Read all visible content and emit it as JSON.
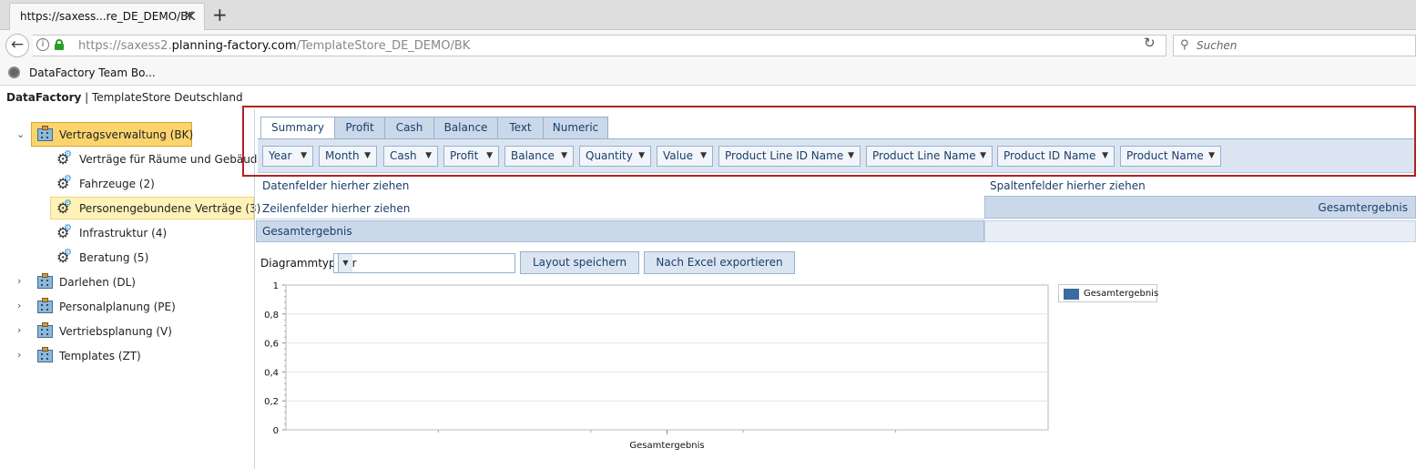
{
  "browser": {
    "tab_title": "https://saxess...re_DE_DEMO/BK",
    "url_prefix": "https://saxess2.",
    "url_host": "planning-factory.com",
    "url_path": "/TemplateStore_DE_DEMO/BK",
    "search_placeholder": "Suchen",
    "bookmark": "DataFactory Team Bo..."
  },
  "app": {
    "brand": "DataFactory",
    "separator": " | ",
    "subtitle": "TemplateStore Deutschland"
  },
  "tree": {
    "root_label": "Vertragsverwaltung (BK)",
    "children": [
      {
        "label": "Verträge für Räume und Gebäude"
      },
      {
        "label": "Fahrzeuge (2)"
      },
      {
        "label": "Personengebundene Verträge (3)"
      },
      {
        "label": "Infrastruktur (4)"
      },
      {
        "label": "Beratung (5)"
      }
    ],
    "others": [
      {
        "label": "Darlehen (DL)"
      },
      {
        "label": "Personalplanung (PE)"
      },
      {
        "label": "Vertriebsplanung (V)"
      },
      {
        "label": "Templates (ZT)"
      }
    ]
  },
  "pivot": {
    "tabs": [
      "Summary",
      "Profit",
      "Cash",
      "Balance",
      "Text",
      "Numeric"
    ],
    "active_tab": "Summary",
    "fields": [
      "Year",
      "Month",
      "Cash",
      "Profit",
      "Balance",
      "Quantity",
      "Value",
      "Product Line ID Name",
      "Product Line Name",
      "Product ID Name",
      "Product Name"
    ],
    "data_drop": "Datenfelder hierher ziehen",
    "column_drop": "Spaltenfelder hierher ziehen",
    "row_drop": "Zeilenfelder hierher ziehen",
    "grand_total_row": "Gesamtergebnis",
    "grand_total_col": "Gesamtergebnis"
  },
  "controls": {
    "chart_type_label": "Diagrammtyp",
    "chart_type_value": "Bar",
    "save_layout": "Layout speichern",
    "export_excel": "Nach Excel exportieren"
  },
  "chart_data": {
    "type": "bar",
    "categories": [
      "Gesamtergebnis"
    ],
    "series": [
      {
        "name": "Gesamtergebnis",
        "values": [
          0
        ]
      }
    ],
    "y_ticks": [
      "1",
      "0,8",
      "0,6",
      "0,4",
      "0,2",
      "0"
    ],
    "ylim": [
      0,
      1
    ],
    "legend": "right",
    "colors": {
      "series": "#3b6a9e"
    }
  }
}
